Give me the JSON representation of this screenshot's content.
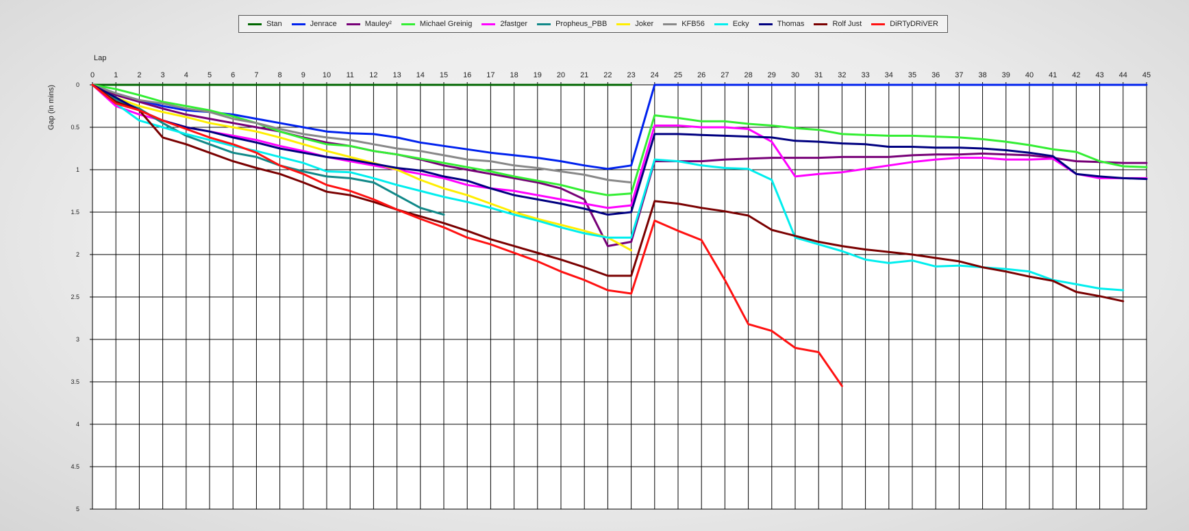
{
  "chart_data": {
    "type": "line",
    "title": "",
    "xlabel": "Lap",
    "ylabel": "Gap (in mins)",
    "xlim": [
      0,
      45
    ],
    "ylim": [
      0,
      5
    ],
    "y_inverted": true,
    "grid": true,
    "legend": "top",
    "x_ticks": [
      0,
      1,
      2,
      3,
      4,
      5,
      6,
      7,
      8,
      9,
      10,
      11,
      12,
      13,
      14,
      15,
      16,
      17,
      18,
      19,
      20,
      21,
      22,
      23,
      24,
      25,
      26,
      27,
      28,
      29,
      30,
      31,
      32,
      33,
      34,
      35,
      36,
      37,
      38,
      39,
      40,
      41,
      42,
      43,
      44,
      45
    ],
    "y_ticks": [
      "0",
      "0.5",
      "1",
      "1.5",
      "2",
      "2.5",
      "3",
      "3.5",
      "4",
      "4.5",
      "5"
    ],
    "y_tick_values": [
      0,
      0.5,
      1,
      1.5,
      2,
      2.5,
      3,
      3.5,
      4,
      4.5,
      5
    ],
    "series": [
      {
        "name": "Stan",
        "color": "#006600",
        "start": 0,
        "values": [
          0,
          0,
          0,
          0,
          0,
          0,
          0,
          0,
          0,
          0,
          0,
          0,
          0,
          0,
          0,
          0,
          0,
          0,
          0,
          0,
          0,
          0,
          0,
          0
        ]
      },
      {
        "name": "Jenrace",
        "color": "#0022ee",
        "start": 0,
        "values": [
          0,
          0.1,
          0.18,
          0.25,
          0.3,
          0.32,
          0.35,
          0.4,
          0.45,
          0.5,
          0.55,
          0.57,
          0.58,
          0.62,
          0.68,
          0.72,
          0.76,
          0.8,
          0.83,
          0.86,
          0.9,
          0.95,
          0.99,
          0.95,
          0,
          0,
          0,
          0,
          0,
          0,
          0,
          0,
          0,
          0,
          0,
          0,
          0,
          0,
          0,
          0,
          0,
          0,
          0,
          0,
          0,
          0
        ]
      },
      {
        "name": "Mauley²",
        "color": "#770077",
        "start": 0,
        "values": [
          0,
          0.12,
          0.2,
          0.28,
          0.35,
          0.4,
          0.45,
          0.5,
          0.55,
          0.62,
          0.68,
          0.72,
          0.78,
          0.82,
          0.88,
          0.95,
          1,
          1.05,
          1.1,
          1.15,
          1.22,
          1.35,
          1.9,
          1.85,
          0.9,
          0.9,
          0.9,
          0.88,
          0.87,
          0.86,
          0.86,
          0.86,
          0.85,
          0.85,
          0.85,
          0.83,
          0.82,
          0.82,
          0.81,
          0.82,
          0.83,
          0.86,
          0.9,
          0.91,
          0.92,
          0.92
        ]
      },
      {
        "name": "Michael Greinig",
        "color": "#33ee33",
        "start": 0,
        "values": [
          0,
          0.05,
          0.12,
          0.2,
          0.25,
          0.3,
          0.37,
          0.45,
          0.55,
          0.63,
          0.7,
          0.72,
          0.78,
          0.82,
          0.87,
          0.92,
          0.97,
          1.02,
          1.08,
          1.13,
          1.18,
          1.25,
          1.3,
          1.28,
          0.36,
          0.39,
          0.43,
          0.43,
          0.46,
          0.48,
          0.51,
          0.53,
          0.58,
          0.59,
          0.6,
          0.6,
          0.61,
          0.62,
          0.64,
          0.67,
          0.71,
          0.76,
          0.79,
          0.9,
          0.96,
          0.97
        ]
      },
      {
        "name": "2fastger",
        "color": "#ff00ff",
        "start": 0,
        "values": [
          0,
          0.25,
          0.35,
          0.42,
          0.5,
          0.55,
          0.6,
          0.65,
          0.72,
          0.78,
          0.85,
          0.9,
          0.95,
          1,
          1.05,
          1.1,
          1.18,
          1.22,
          1.25,
          1.3,
          1.35,
          1.4,
          1.45,
          1.42,
          0.48,
          0.48,
          0.5,
          0.5,
          0.52,
          0.67,
          1.08,
          1.05,
          1.03,
          0.99,
          0.95,
          0.91,
          0.88,
          0.86,
          0.86,
          0.88,
          0.88,
          0.87,
          1.05,
          1.1,
          1.1,
          1.1
        ]
      },
      {
        "name": "Propheus_PBB",
        "color": "#118888",
        "start": 0,
        "values": [
          0,
          0.18,
          0.28,
          0.45,
          0.6,
          0.7,
          0.8,
          0.85,
          0.95,
          1.02,
          1.08,
          1.1,
          1.15,
          1.3,
          1.45,
          1.53
        ]
      },
      {
        "name": "Joker",
        "color": "#ffee00",
        "start": 0,
        "values": [
          0,
          0.15,
          0.25,
          0.32,
          0.38,
          0.45,
          0.5,
          0.55,
          0.62,
          0.7,
          0.78,
          0.85,
          0.92,
          1,
          1.12,
          1.22,
          1.3,
          1.4,
          1.5,
          1.58,
          1.65,
          1.72,
          1.8,
          1.95
        ]
      },
      {
        "name": "KFB56",
        "color": "#888888",
        "start": 0,
        "values": [
          0,
          0.1,
          0.18,
          0.22,
          0.28,
          0.32,
          0.4,
          0.45,
          0.52,
          0.58,
          0.62,
          0.65,
          0.7,
          0.75,
          0.78,
          0.83,
          0.88,
          0.9,
          0.95,
          0.98,
          1.02,
          1.06,
          1.12,
          1.15
        ]
      },
      {
        "name": "Ecky",
        "color": "#00eeee",
        "start": 0,
        "values": [
          0,
          0.22,
          0.42,
          0.5,
          0.58,
          0.65,
          0.72,
          0.78,
          0.85,
          0.92,
          1.02,
          1.03,
          1.1,
          1.18,
          1.25,
          1.32,
          1.38,
          1.45,
          1.53,
          1.6,
          1.68,
          1.75,
          1.8,
          1.8,
          0.88,
          0.9,
          0.95,
          0.98,
          0.99,
          1.12,
          1.8,
          1.88,
          1.96,
          2.06,
          2.1,
          2.07,
          2.14,
          2.13,
          2.15,
          2.17,
          2.2,
          2.3,
          2.35,
          2.4,
          2.42
        ]
      },
      {
        "name": "Thomas",
        "color": "#000080",
        "start": 0,
        "values": [
          0,
          0.15,
          0.3,
          0.42,
          0.5,
          0.55,
          0.62,
          0.68,
          0.75,
          0.8,
          0.85,
          0.88,
          0.93,
          0.98,
          1.01,
          1.08,
          1.13,
          1.22,
          1.3,
          1.35,
          1.4,
          1.46,
          1.53,
          1.5,
          0.58,
          0.58,
          0.59,
          0.6,
          0.61,
          0.62,
          0.66,
          0.67,
          0.69,
          0.7,
          0.73,
          0.73,
          0.74,
          0.74,
          0.75,
          0.77,
          0.8,
          0.84,
          1.05,
          1.08,
          1.1,
          1.11
        ]
      },
      {
        "name": "Rolf Just",
        "color": "#7a0000",
        "start": 0,
        "values": [
          0,
          0.2,
          0.3,
          0.62,
          0.7,
          0.8,
          0.9,
          0.98,
          1.05,
          1.15,
          1.26,
          1.3,
          1.38,
          1.47,
          1.55,
          1.63,
          1.72,
          1.82,
          1.9,
          1.98,
          2.06,
          2.15,
          2.25,
          2.25,
          1.37,
          1.4,
          1.45,
          1.49,
          1.54,
          1.71,
          1.78,
          1.85,
          1.9,
          1.94,
          1.97,
          2,
          2.04,
          2.08,
          2.15,
          2.2,
          2.26,
          2.31,
          2.44,
          2.49,
          2.55
        ]
      },
      {
        "name": "DiRTyDRiVER",
        "color": "#ff1111",
        "start": 0,
        "values": [
          0,
          0.22,
          0.3,
          0.42,
          0.52,
          0.62,
          0.7,
          0.8,
          0.95,
          1.05,
          1.18,
          1.25,
          1.35,
          1.47,
          1.58,
          1.68,
          1.8,
          1.88,
          1.98,
          2.08,
          2.2,
          2.3,
          2.42,
          2.46,
          1.6,
          1.72,
          1.83,
          2.3,
          2.82,
          2.9,
          3.1,
          3.15,
          3.55
        ]
      }
    ]
  }
}
